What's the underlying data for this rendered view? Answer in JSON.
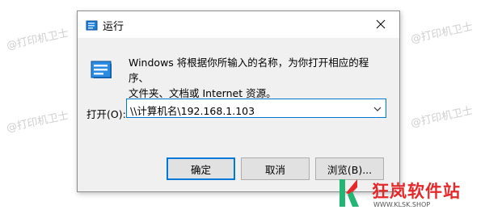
{
  "watermark": {
    "text": "@打印机卫士"
  },
  "dialog": {
    "title": "运行",
    "description_line1": "Windows 将根据你所输入的名称，为你打开相应的程序、",
    "description_line2": "文件夹、文档或 Internet 资源。",
    "open_label": "打开(O):",
    "open_value": "\\\\计算机名\\192.168.1.103",
    "buttons": {
      "ok": "确定",
      "cancel": "取消",
      "browse": "浏览(B)..."
    }
  },
  "logo": {
    "name": "狂岚软件站",
    "url": "WWW.KLSK.SHOP"
  },
  "colors": {
    "accent": "#0078d7",
    "logo_red": "#e5282a",
    "logo_green": "#22b573"
  },
  "icons": {
    "title": "run-app-icon",
    "main": "run-app-icon",
    "close": "close-icon",
    "dropdown": "chevron-down-icon"
  }
}
